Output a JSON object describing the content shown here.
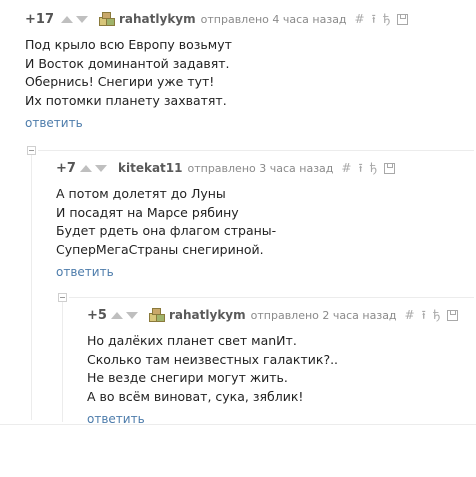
{
  "comments": [
    {
      "rating": "+17",
      "username": "rahatlykym",
      "posted": "отправлено 4 часа назад",
      "tools": {
        "link": "#",
        "parent": "⭱",
        "branch": "ђ"
      },
      "lines": [
        "Под крыло всю Европу возьмут",
        "И Восток доминантой задавят.",
        "Обернись! Снегири уже тут!",
        "Их потомки планету захватят."
      ],
      "reply": "ответить"
    },
    {
      "rating": "+7",
      "username": "kitekat11",
      "posted": "отправлено 3 часа назад",
      "tools": {
        "link": "#",
        "parent": "⭱",
        "branch": "ђ"
      },
      "lines": [
        "А потом долетят до Луны",
        "И посадят на Марсе рябину",
        "Будет рдеть она флагом страны-",
        "СуперМегаСтраны снегириной."
      ],
      "reply": "ответить"
    },
    {
      "rating": "+5",
      "username": "rahatlykym",
      "posted": "отправлено 2 часа назад",
      "tools": {
        "link": "#",
        "parent": "⭱",
        "branch": "ђ"
      },
      "lines": [
        "Но далёких планет свет маnИт.",
        "Сколько там неизвестных галактик?..",
        "Не везде снегири могут жить.",
        "А во всём виноват, сука, зяблик!"
      ],
      "reply": "ответить"
    }
  ]
}
